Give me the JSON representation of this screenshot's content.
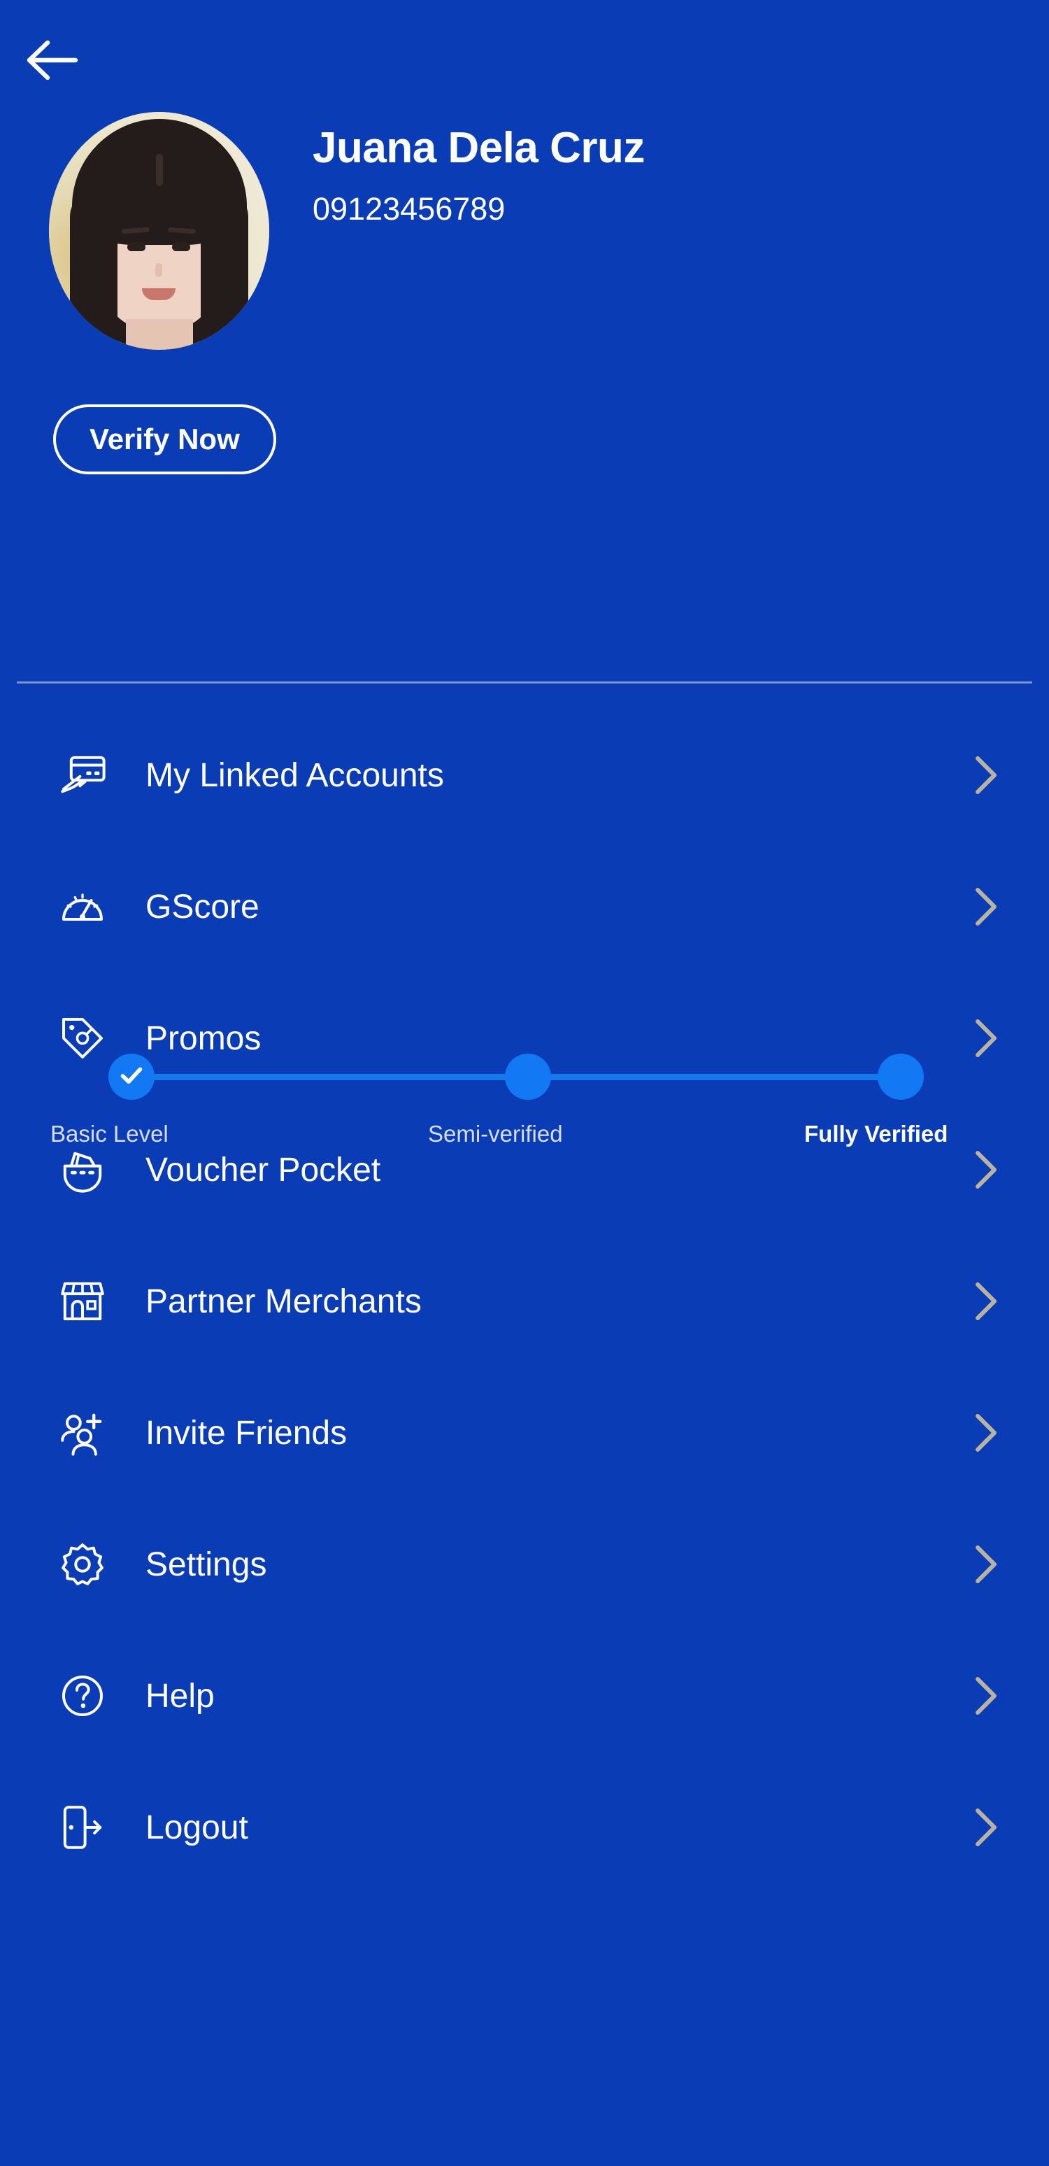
{
  "theme": {
    "background": "#0A3DB5",
    "accent_dot": "#1278F3",
    "accent_line": "#1678EE",
    "text_primary": "#FFFFFF",
    "text_muted": "#D7DDEC",
    "chevron": "#B9B2A0",
    "divider": "#8AA2D6"
  },
  "header": {
    "back_label": "Back",
    "back_icon": "arrow-left-icon"
  },
  "profile": {
    "name": "Juana Dela Cruz",
    "phone": "09123456789",
    "avatar_alt": "Juana Dela Cruz profile photo",
    "verify_button": "Verify Now"
  },
  "verification": {
    "steps": [
      {
        "label": "Basic Level",
        "state": "completed",
        "icon": "check-icon"
      },
      {
        "label": "Semi-verified",
        "state": "pending",
        "icon": ""
      },
      {
        "label": "Fully Verified",
        "state": "pending",
        "icon": ""
      }
    ]
  },
  "menu": {
    "items": [
      {
        "label": "My Linked Accounts",
        "icon": "credit-card-swipe-icon",
        "chevron": "chevron-right-icon"
      },
      {
        "label": "GScore",
        "icon": "gauge-icon",
        "chevron": "chevron-right-icon"
      },
      {
        "label": "Promos",
        "icon": "price-tag-icon",
        "chevron": "chevron-right-icon"
      },
      {
        "label": "Voucher Pocket",
        "icon": "voucher-pocket-icon",
        "chevron": "chevron-right-icon"
      },
      {
        "label": "Partner Merchants",
        "icon": "storefront-icon",
        "chevron": "chevron-right-icon"
      },
      {
        "label": "Invite Friends",
        "icon": "user-plus-icon",
        "chevron": "chevron-right-icon"
      },
      {
        "label": "Settings",
        "icon": "gear-icon",
        "chevron": "chevron-right-icon"
      },
      {
        "label": "Help",
        "icon": "question-circle-icon",
        "chevron": "chevron-right-icon"
      },
      {
        "label": "Logout",
        "icon": "logout-door-icon",
        "chevron": "chevron-right-icon"
      }
    ]
  }
}
